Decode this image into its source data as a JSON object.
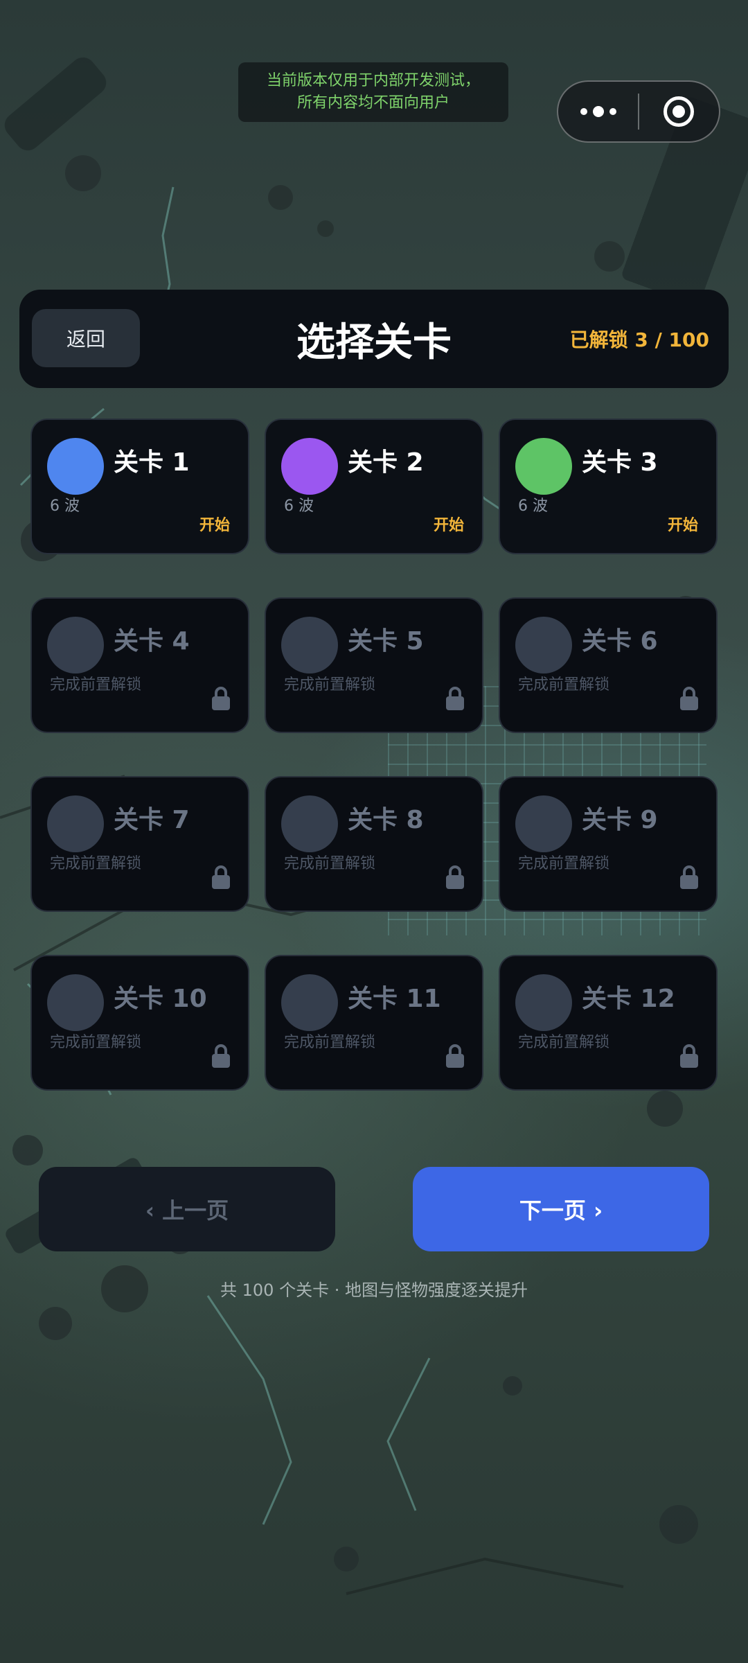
{
  "dev_notice": {
    "line1": "当前版本仅用于内部开发测试，",
    "line2": "所有内容均不面向用户"
  },
  "header": {
    "back_label": "返回",
    "title": "选择关卡",
    "unlock_status": "已解锁 3 / 100"
  },
  "levels": [
    {
      "name": "关卡 1",
      "sub": "6 波",
      "action": "开始",
      "locked": false,
      "color": "#4f86ef"
    },
    {
      "name": "关卡 2",
      "sub": "6 波",
      "action": "开始",
      "locked": false,
      "color": "#9b57f0"
    },
    {
      "name": "关卡 3",
      "sub": "6 波",
      "action": "开始",
      "locked": false,
      "color": "#5ec466"
    },
    {
      "name": "关卡 4",
      "sub": "完成前置解锁",
      "locked": true,
      "color": "#353e4d"
    },
    {
      "name": "关卡 5",
      "sub": "完成前置解锁",
      "locked": true,
      "color": "#353e4d"
    },
    {
      "name": "关卡 6",
      "sub": "完成前置解锁",
      "locked": true,
      "color": "#353e4d"
    },
    {
      "name": "关卡 7",
      "sub": "完成前置解锁",
      "locked": true,
      "color": "#353e4d"
    },
    {
      "name": "关卡 8",
      "sub": "完成前置解锁",
      "locked": true,
      "color": "#353e4d"
    },
    {
      "name": "关卡 9",
      "sub": "完成前置解锁",
      "locked": true,
      "color": "#353e4d"
    },
    {
      "name": "关卡 10",
      "sub": "完成前置解锁",
      "locked": true,
      "color": "#353e4d"
    },
    {
      "name": "关卡 11",
      "sub": "完成前置解锁",
      "locked": true,
      "color": "#353e4d"
    },
    {
      "name": "关卡 12",
      "sub": "完成前置解锁",
      "locked": true,
      "color": "#353e4d"
    }
  ],
  "pagination": {
    "prev_label": "‹ 上一页",
    "next_label": "下一页 ›"
  },
  "footer_note": "共 100 个关卡 · 地图与怪物强度逐关提升",
  "colors": {
    "accent_gold": "#f2b53a",
    "primary_blue": "#3d67e6",
    "notice_green": "#7fd36b"
  }
}
